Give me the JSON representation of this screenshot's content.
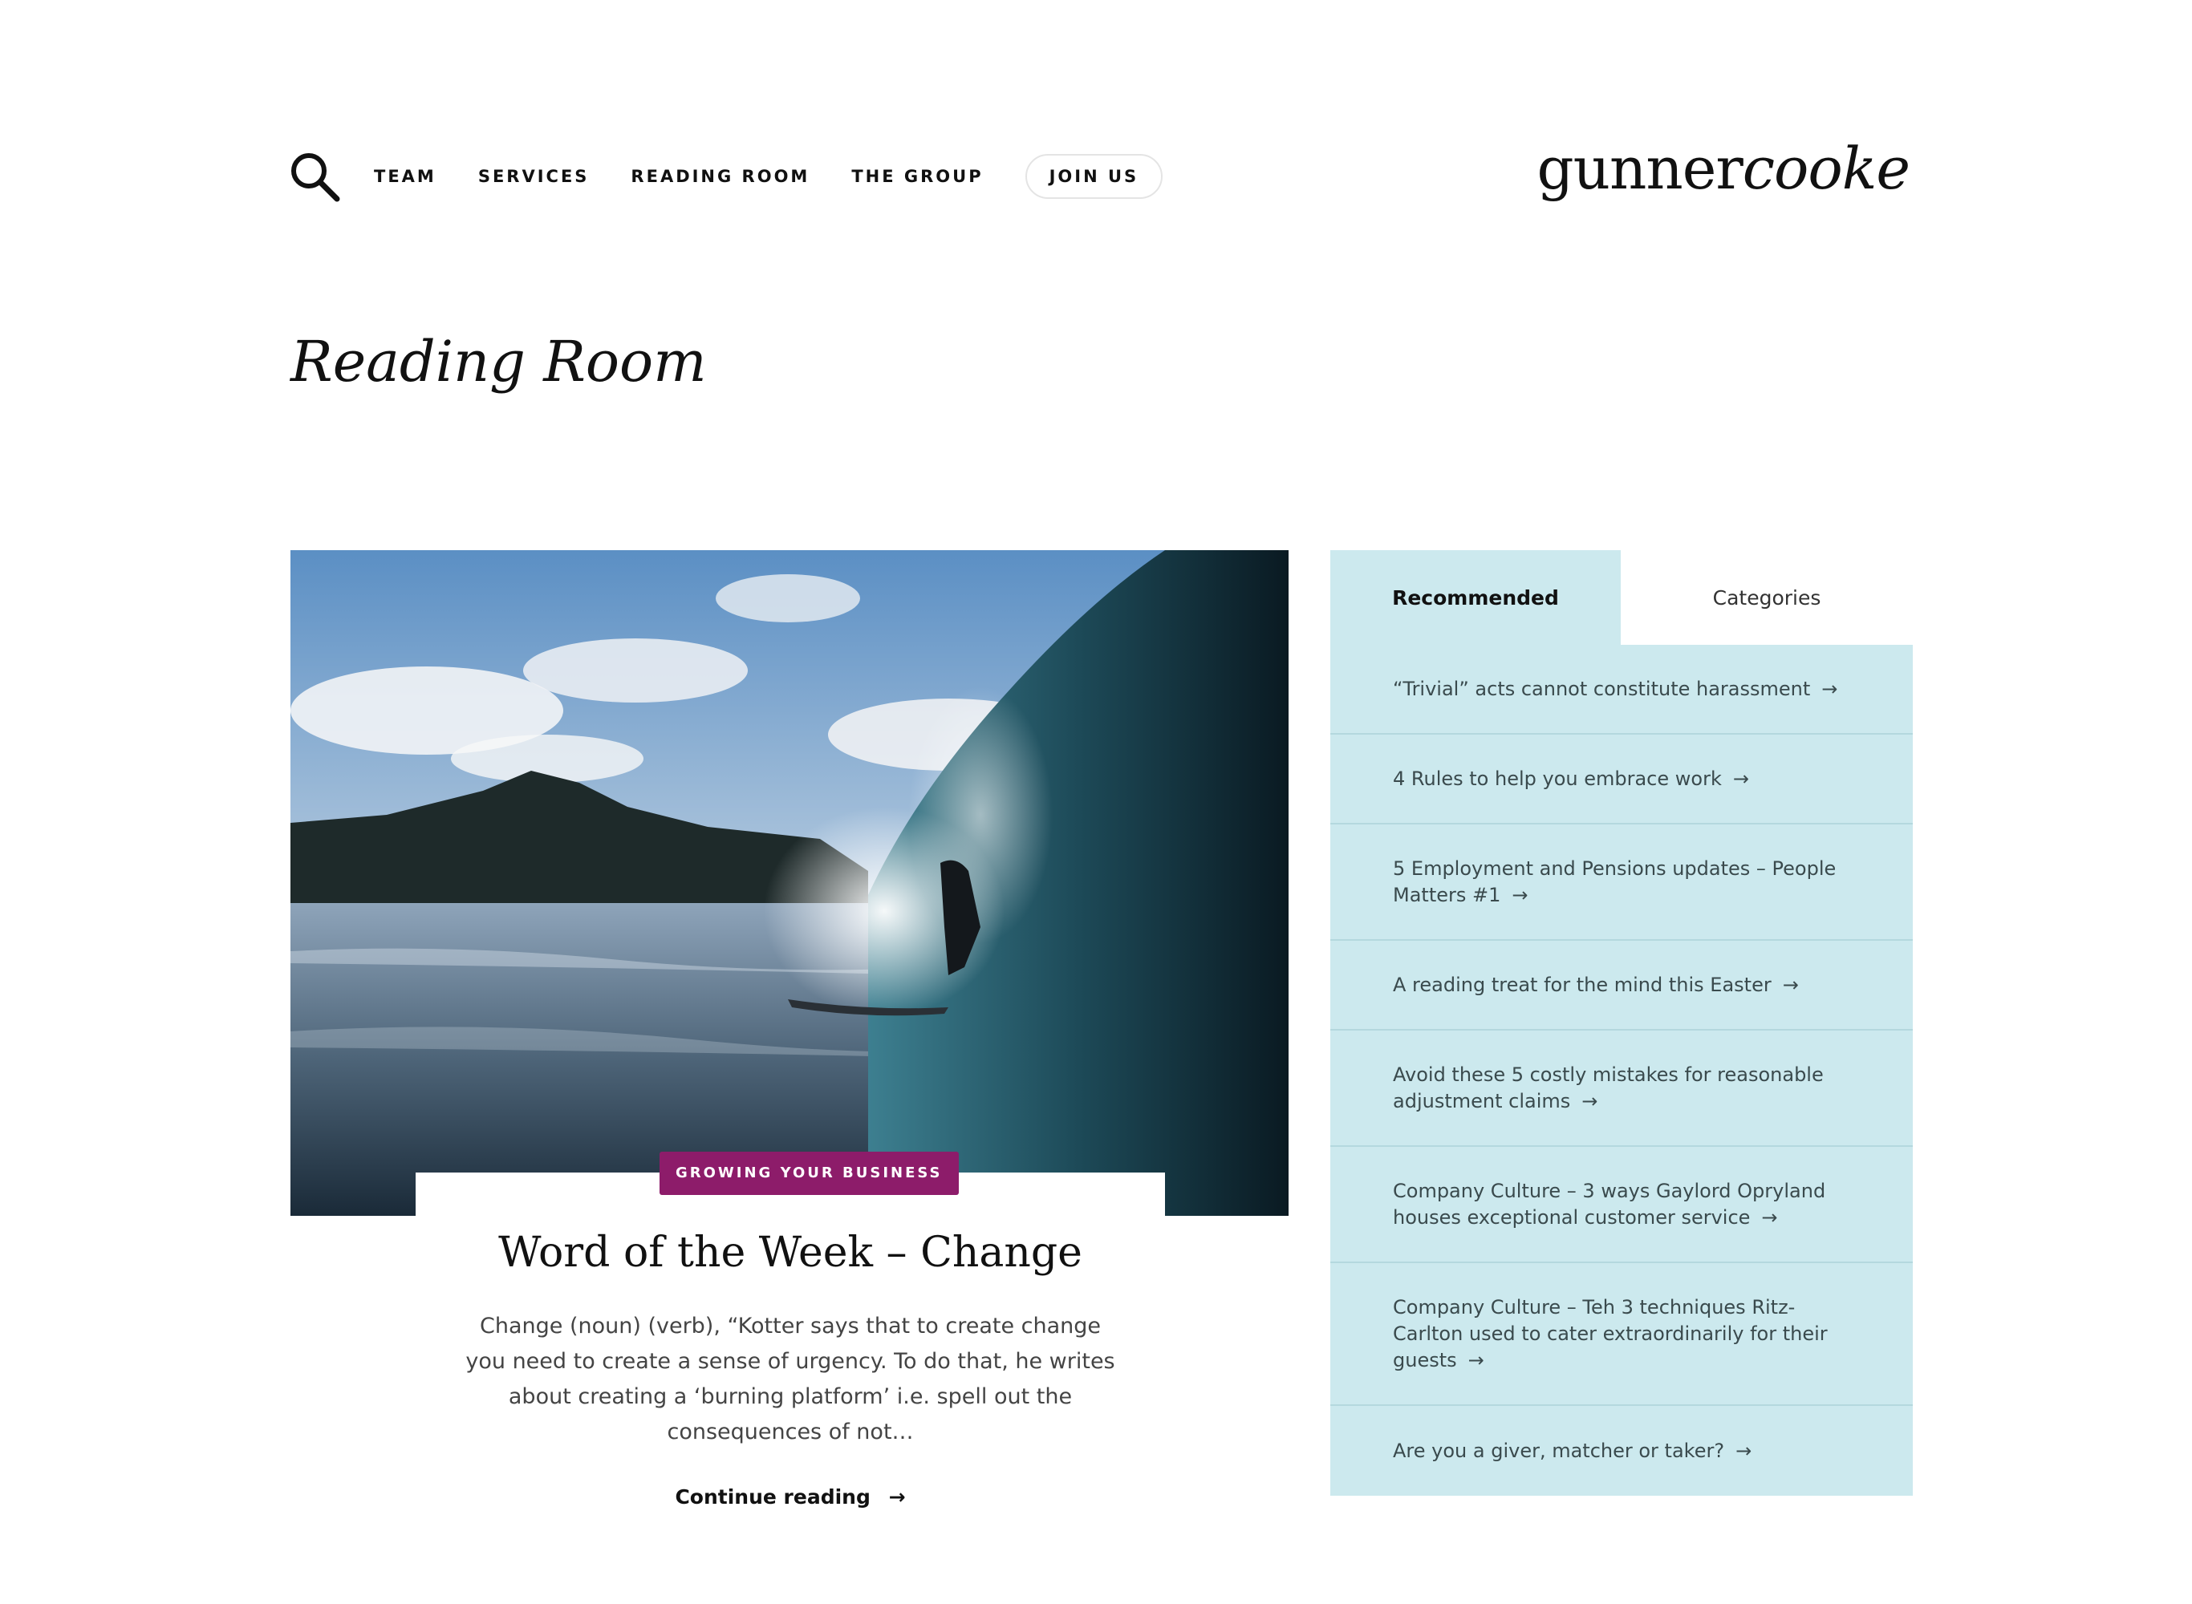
{
  "header": {
    "nav": [
      "TEAM",
      "SERVICES",
      "READING ROOM",
      "THE GROUP"
    ],
    "join_label": "JOIN US",
    "logo_part1": "gunner",
    "logo_part2": "cooke"
  },
  "page": {
    "title": "Reading Room"
  },
  "featured": {
    "badge": "GROWING YOUR BUSINESS",
    "title": "Word of the Week – Change",
    "excerpt": "Change (noun) (verb), “Kotter says that to create change you need to create a sense of urgency. To do that, he writes about creating a ‘burning platform’ i.e. spell out the consequences of not…",
    "continue_label": "Continue reading",
    "arrow": "→"
  },
  "sidebar": {
    "tabs": [
      "Recommended",
      "Categories"
    ],
    "active_tab": "Recommended",
    "items": [
      "“Trivial” acts cannot constitute harassment",
      "4 Rules to help you embrace work",
      "5 Employment and Pensions updates – People Matters #1",
      "A reading treat for the mind this Easter",
      "Avoid these 5 costly mistakes for reasonable adjustment claims",
      "Company Culture – 3 ways Gaylord Opryland houses exceptional customer service",
      "Company Culture – Teh 3 techniques Ritz-Carlton used to cater extraordinarily for their guests",
      "Are you a giver, matcher or taker?"
    ],
    "arrow": "→"
  },
  "colors": {
    "sidebar_bg": "#cce9ee",
    "badge_bg": "#8d1c6a",
    "text": "#111111"
  },
  "icons": {
    "search": "search-icon",
    "arrow": "arrow-right-icon"
  }
}
